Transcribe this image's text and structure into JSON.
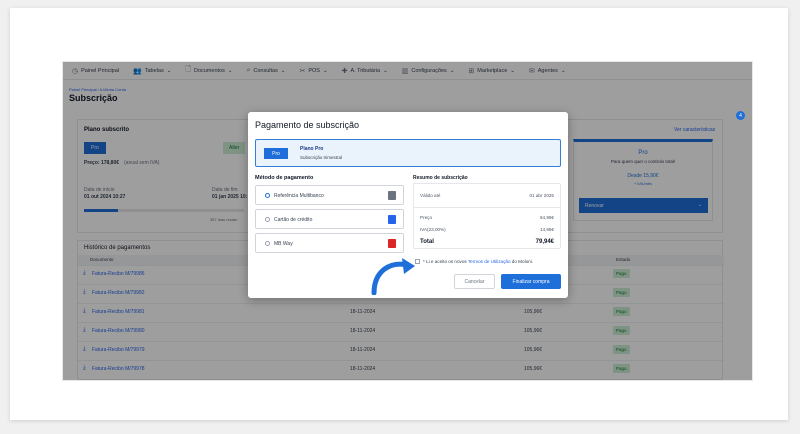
{
  "nav": [
    {
      "label": "Painel Principal",
      "icon": "dashboard-icon",
      "glyph": "◷"
    },
    {
      "label": "Tabelas",
      "icon": "users-icon",
      "glyph": "👥"
    },
    {
      "label": "Documentos",
      "icon": "document-icon",
      "glyph": "🗋"
    },
    {
      "label": "Consultas",
      "icon": "search-icon",
      "glyph": "⌕"
    },
    {
      "label": "POS",
      "icon": "pos-icon",
      "glyph": "✂"
    },
    {
      "label": "A. Tributária",
      "icon": "tax-icon",
      "glyph": "✚"
    },
    {
      "label": "Configurações",
      "icon": "settings-icon",
      "glyph": "▥"
    },
    {
      "label": "Marketplace",
      "icon": "marketplace-icon",
      "glyph": "⊞"
    },
    {
      "label": "Agentes",
      "icon": "agents-icon",
      "glyph": "✉"
    }
  ],
  "breadcrumb": "Painel Principal  /  A Minha Conta",
  "page_title": "Subscrição",
  "plan_panel": {
    "title": "Plano subscrito",
    "plan_badge": "Pro",
    "price": "Preço: 178,80€",
    "price_note": "(anual sem IVA)",
    "alter_button": "Alter",
    "start_label": "Data de início",
    "start_value": "01 out 2024 10:27",
    "end_label": "Data de fim",
    "end_value": "01 jan 2025 10:",
    "days_text": "357 dias restan",
    "features_link": "Ver características",
    "right_plan": "Pro",
    "right_desc": "Para quem quer o controlo total!",
    "right_price": "Desde 15,90€",
    "right_iva": "+ IVA/mês",
    "renew_button": "Renovar"
  },
  "history": {
    "title": "Histórico de pagamentos",
    "columns": [
      "Documento",
      "Estado"
    ],
    "rows": [
      {
        "doc": "Fatura-Recibo M/79986",
        "date": "",
        "value": "",
        "status": "Pago"
      },
      {
        "doc": "Fatura-Recibo M/79982",
        "date": "",
        "value": "",
        "status": "Pago"
      },
      {
        "doc": "Fatura-Recibo M/79981",
        "date": "18-11-2024",
        "value": "105,96€",
        "status": "Pago"
      },
      {
        "doc": "Fatura-Recibo M/79980",
        "date": "18-11-2024",
        "value": "105,96€",
        "status": "Pago"
      },
      {
        "doc": "Fatura-Recibo M/79979",
        "date": "18-11-2024",
        "value": "105,96€",
        "status": "Pago"
      },
      {
        "doc": "Fatura-Recibo M/79978",
        "date": "18-11-2024",
        "value": "105,96€",
        "status": "Pago"
      }
    ]
  },
  "modal": {
    "title": "Pagamento de subscrição",
    "plan_chip": "Pro",
    "plan_name": "Plano Pro",
    "plan_desc": "Subscrição trimestral",
    "method_title": "Método de pagamento",
    "methods": [
      {
        "label": "Referência Multibanco",
        "icon": "multibanco-icon",
        "color": "#6b7280"
      },
      {
        "label": "Cartão de crédito",
        "icon": "credit-card-icon",
        "color": "#2563eb"
      },
      {
        "label": "MB Way",
        "icon": "mbway-icon",
        "color": "#dc2626"
      }
    ],
    "summary_title": "Resumo de subscrição",
    "valid_label": "Válido até",
    "valid_value": "01 abr 2025",
    "price_label": "Preço",
    "price_value": "64,99€",
    "iva_label": "IVA(23,00%)",
    "iva_value": "14,95€",
    "total_label": "Total",
    "total_value": "79,94€",
    "terms_prefix": "* Li e aceito os novos",
    "terms_link": "Termos de Utilização",
    "terms_suffix": "do Moloni.",
    "cancel": "Cancelar",
    "buy": "Finalizar compra"
  },
  "notification_count": "4",
  "colors": {
    "accent": "#1e6fd9",
    "success_bg": "#cdeed6",
    "success_text": "#0f7a35",
    "arrow": "#1e6fd9"
  }
}
